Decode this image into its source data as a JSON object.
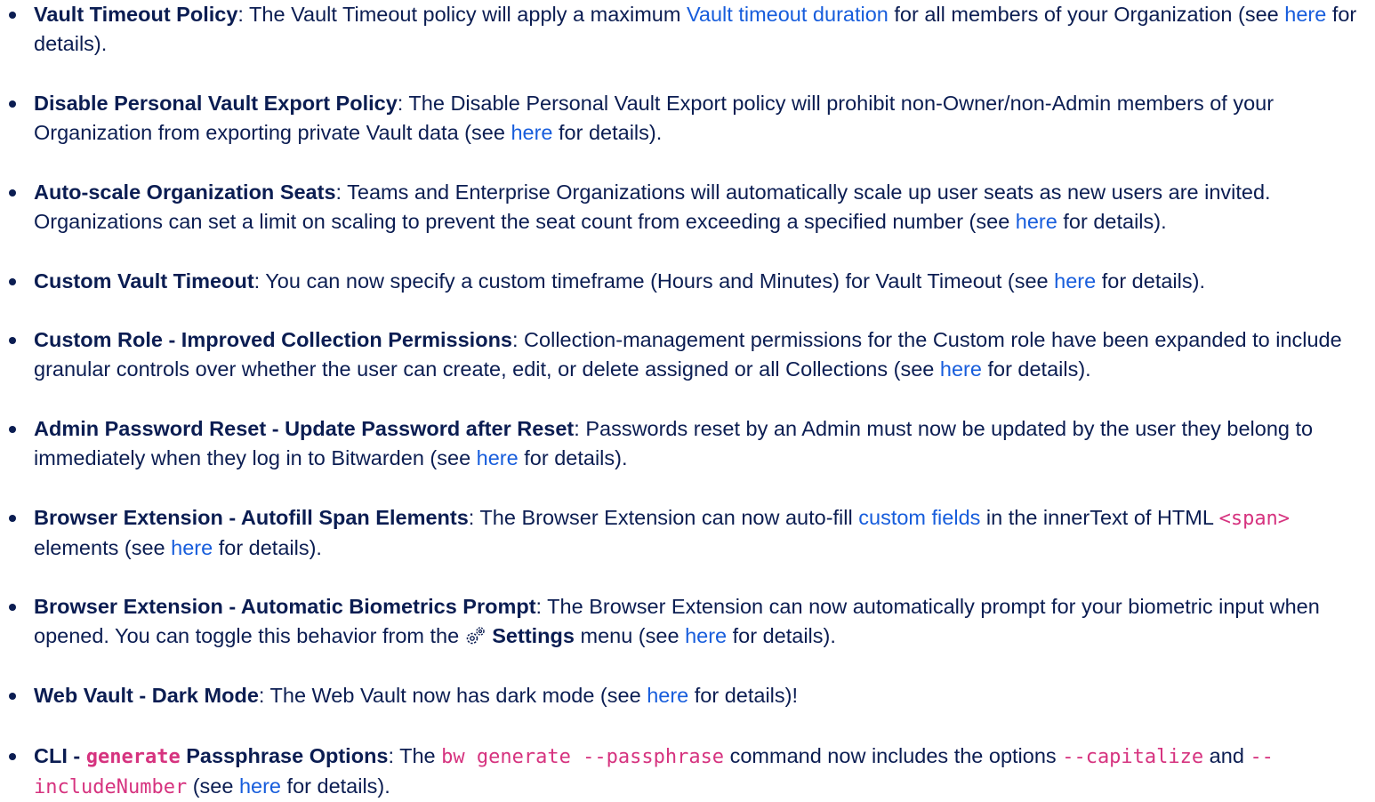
{
  "items": [
    {
      "title": "Vault Timeout Policy",
      "t1": ": The Vault Timeout policy will apply a maximum ",
      "link1": "Vault timeout duration",
      "t2": " for all members of your Organization (see ",
      "link2": "here",
      "t3": " for details)."
    },
    {
      "title": "Disable Personal Vault Export Policy",
      "t1": ": The Disable Personal Vault Export policy will prohibit non-Owner/non-Admin members of your Organization from exporting private Vault data (see ",
      "link1": "here",
      "t2": " for details)."
    },
    {
      "title": "Auto-scale Organization Seats",
      "t1": ": Teams and Enterprise Organizations will automatically scale up user seats as new users are invited. Organizations can set a limit on scaling to prevent the seat count from exceeding a specified number (see ",
      "link1": "here",
      "t2": " for details)."
    },
    {
      "title": "Custom Vault Timeout",
      "t1": ": You can now specify a custom timeframe (Hours and Minutes) for Vault Timeout (see ",
      "link1": "here",
      "t2": " for details)."
    },
    {
      "title": "Custom Role - Improved Collection Permissions",
      "t1": ": Collection-management permissions for the Custom role have been expanded to include granular controls over whether the user can create, edit, or delete assigned or all Collections (see ",
      "link1": "here",
      "t2": " for details)."
    },
    {
      "title": "Admin Password Reset - Update Password after Reset",
      "t1": ": Passwords reset by an Admin must now be updated by the user they belong to immediately when they log in to Bitwarden (see ",
      "link1": "here",
      "t2": " for details)."
    },
    {
      "title": "Browser Extension - Autofill Span Elements",
      "t1": ": The Browser Extension can now auto-fill ",
      "link1": "custom fields",
      "t2": " in the innerText of HTML ",
      "code1": "<span>",
      "t3": " elements (see ",
      "link2": "here",
      "t4": " for details)."
    },
    {
      "title": "Browser Extension - Automatic Biometrics Prompt",
      "t1": ": The Browser Extension can now automatically prompt for your biometric input when opened. You can toggle this behavior from the ",
      "icon": "gears-icon",
      "bold1": "Settings",
      "t2": " menu (see ",
      "link1": "here",
      "t3": " for details)."
    },
    {
      "title": "Web Vault - Dark Mode",
      "t1": ": The Web Vault now has dark mode (see ",
      "link1": "here",
      "t2": " for details)!"
    },
    {
      "title_a": "CLI - ",
      "title_code": "generate",
      "title_b": " Passphrase Options",
      "t1": ": The ",
      "code1": "bw generate --passphrase",
      "t2": " command now includes the options ",
      "code2": "--capitalize",
      "t3": " and ",
      "code3": "--includeNumber",
      "t4": " (see ",
      "link1": "here",
      "t5": " for details)."
    }
  ]
}
